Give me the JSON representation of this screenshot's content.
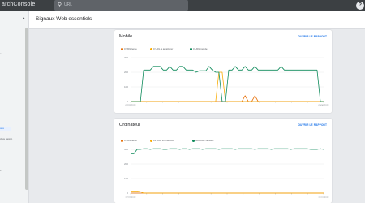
{
  "app": {
    "brand": "archConsole"
  },
  "search": {
    "placeholder": "URL"
  },
  "header": {
    "title": "Signaux Web essentiels"
  },
  "sidebar": {
    "items": [
      "e.",
      "ons",
      "ctive assist.",
      "it"
    ]
  },
  "colors": {
    "good": "#0d8a5a",
    "needs_improvement": "#f9ab00",
    "poor": "#e8710a",
    "link": "#1a73e8"
  },
  "icons": {
    "help": "help-icon",
    "search": "search-icon",
    "collapse": "chevron-icon"
  },
  "cards": [
    {
      "title": "Mobile",
      "link": "OUVRIR LE RAPPORT",
      "legend": [
        "0 URL lente",
        "0 URL à améliorer",
        "0 URL rapide"
      ],
      "chart_data": {
        "type": "line",
        "ylabel": "",
        "y_ticks": [
          "300",
          "200",
          "100",
          "0"
        ],
        "x_ticks": [
          "07/03/2022",
          "",
          "",
          "",
          "",
          "",
          "",
          "",
          "",
          "",
          "",
          "",
          "04/06/2022"
        ],
        "series": [
          {
            "name": "0 URL rapide",
            "color": "#0d8a5a",
            "values": [
              0,
              0,
              0,
              0,
              215,
              215,
              215,
              240,
              240,
              240,
              215,
              215,
              240,
              215,
              215,
              240,
              240,
              215,
              215,
              215,
              200,
              210,
              210,
              210,
              240,
              215,
              200,
              200,
              0,
              0,
              215,
              215,
              240,
              215,
              215,
              240,
              215,
              215,
              240,
              215,
              215,
              215,
              215,
              215,
              215,
              215,
              240,
              215,
              215,
              215,
              215,
              215,
              215,
              215,
              215,
              215,
              215,
              215,
              0,
              0
            ]
          },
          {
            "name": "0 URL à améliorer",
            "color": "#f9ab00",
            "values": [
              0,
              0,
              0,
              0,
              0,
              0,
              0,
              0,
              0,
              0,
              0,
              0,
              0,
              0,
              0,
              0,
              0,
              0,
              0,
              0,
              0,
              0,
              0,
              0,
              0,
              0,
              0,
              200,
              200,
              0,
              0,
              0,
              0,
              0,
              0,
              0,
              0,
              0,
              0,
              0,
              0,
              0,
              0,
              0,
              0,
              0,
              0,
              0,
              0,
              0,
              0,
              0,
              0,
              0,
              0,
              0,
              0,
              0,
              0,
              0
            ]
          },
          {
            "name": "0 URL lente",
            "color": "#e8710a",
            "values": [
              0,
              0,
              0,
              0,
              0,
              0,
              0,
              0,
              0,
              0,
              0,
              0,
              0,
              0,
              0,
              0,
              0,
              0,
              0,
              0,
              0,
              0,
              0,
              0,
              0,
              0,
              0,
              0,
              0,
              0,
              0,
              0,
              0,
              0,
              0,
              40,
              0,
              0,
              40,
              0,
              0,
              0,
              0,
              0,
              0,
              0,
              0,
              0,
              0,
              0,
              0,
              0,
              0,
              0,
              0,
              0,
              0,
              0,
              0,
              0
            ]
          }
        ]
      }
    },
    {
      "title": "Ordinateur",
      "link": "OUVRIR LE RAPPORT",
      "legend": [
        "0 URL lente",
        "14 URL à améliorer",
        "300 URL rapides"
      ],
      "chart_data": {
        "type": "line",
        "ylabel": "",
        "y_ticks": [
          "300",
          "200",
          "100",
          "0"
        ],
        "x_ticks": [
          "07/03/2022",
          "",
          "",
          "",
          "",
          "",
          "",
          "",
          "",
          "",
          "",
          "",
          "04/06/2022"
        ],
        "series": [
          {
            "name": "300 URL rapides",
            "color": "#0d8a5a",
            "values": [
              270,
              270,
              300,
              300,
              305,
              305,
              300,
              305,
              305,
              305,
              300,
              300,
              305,
              305,
              305,
              300,
              305,
              305,
              300,
              305,
              305,
              305,
              300,
              305,
              305,
              305,
              305,
              300,
              305,
              305,
              305,
              305,
              300,
              305,
              305,
              305,
              305,
              305,
              300,
              305,
              305,
              305,
              305,
              300,
              305,
              305,
              305,
              305,
              305,
              300,
              305,
              305,
              305,
              305,
              305,
              300,
              300,
              300,
              305,
              300
            ]
          },
          {
            "name": "14 URL à améliorer",
            "color": "#f9ab00",
            "values": [
              14,
              14,
              14,
              10,
              0,
              0,
              0,
              0,
              0,
              0,
              0,
              0,
              0,
              0,
              0,
              0,
              0,
              0,
              0,
              0,
              0,
              0,
              0,
              0,
              0,
              0,
              0,
              0,
              0,
              0,
              0,
              0,
              0,
              0,
              0,
              0,
              0,
              0,
              0,
              0,
              0,
              0,
              0,
              0,
              0,
              0,
              0,
              0,
              0,
              0,
              0,
              0,
              0,
              0,
              0,
              0,
              0,
              0,
              0,
              0
            ]
          },
          {
            "name": "0 URL lente",
            "color": "#e8710a",
            "values": [
              0,
              0,
              0,
              0,
              0,
              0,
              0,
              0,
              0,
              0,
              0,
              0,
              0,
              0,
              0,
              0,
              0,
              0,
              0,
              0,
              0,
              0,
              0,
              0,
              0,
              0,
              0,
              0,
              0,
              0,
              0,
              0,
              0,
              0,
              0,
              0,
              0,
              0,
              0,
              0,
              0,
              0,
              0,
              0,
              0,
              0,
              0,
              0,
              0,
              0,
              0,
              0,
              0,
              0,
              0,
              0,
              0,
              0,
              0,
              0
            ]
          }
        ]
      }
    }
  ]
}
